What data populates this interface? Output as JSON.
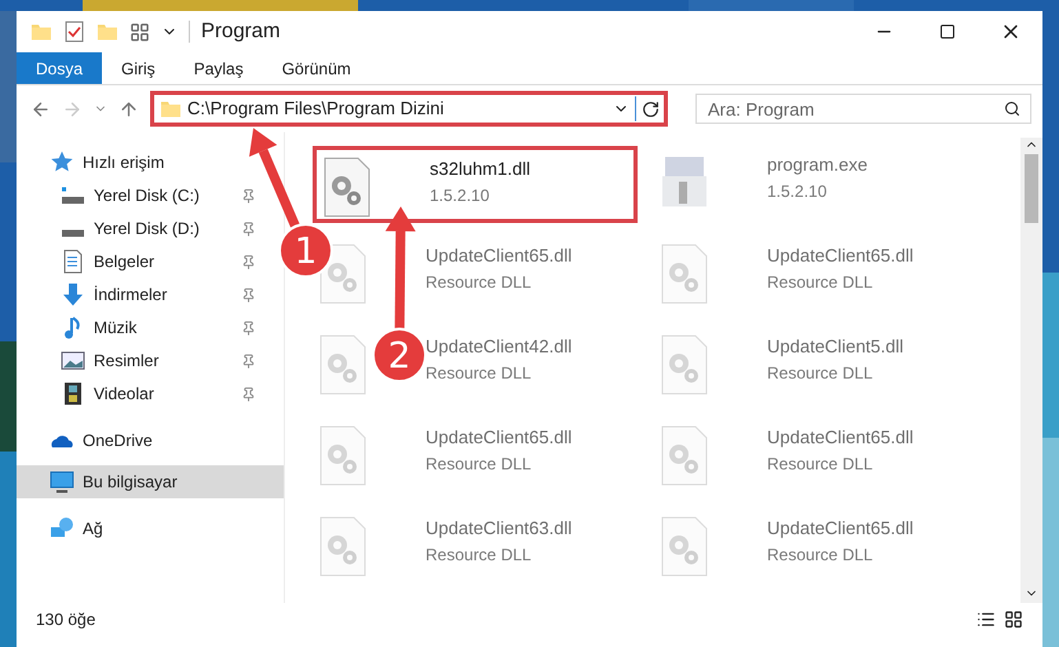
{
  "window": {
    "title": "Program"
  },
  "ribbon_tabs": [
    {
      "label": "Dosya",
      "selected": true
    },
    {
      "label": "Giriş",
      "selected": false
    },
    {
      "label": "Paylaş",
      "selected": false
    },
    {
      "label": "Görünüm",
      "selected": false
    }
  ],
  "address": {
    "path": "C:\\Program Files\\Program Dizini",
    "highlighted": true
  },
  "search": {
    "placeholder": "Ara: Program"
  },
  "sidebar": {
    "items": [
      {
        "label": "Hızlı erişim",
        "kind": "quick",
        "selected": false,
        "pinned": false
      },
      {
        "label": "Yerel Disk (C:)",
        "kind": "diskc",
        "selected": false,
        "pinned": true
      },
      {
        "label": "Yerel Disk (D:)",
        "kind": "disk",
        "selected": false,
        "pinned": true
      },
      {
        "label": "Belgeler",
        "kind": "docs",
        "selected": false,
        "pinned": true
      },
      {
        "label": "İndirmeler",
        "kind": "down",
        "selected": false,
        "pinned": true
      },
      {
        "label": "Müzik",
        "kind": "music",
        "selected": false,
        "pinned": true
      },
      {
        "label": "Resimler",
        "kind": "pics",
        "selected": false,
        "pinned": true
      },
      {
        "label": "Videolar",
        "kind": "video",
        "selected": false,
        "pinned": true
      },
      {
        "label": "OneDrive",
        "kind": "cloud",
        "selected": false,
        "pinned": false
      },
      {
        "label": "Bu bilgisayar",
        "kind": "pc",
        "selected": true,
        "pinned": false
      },
      {
        "label": "Ağ",
        "kind": "net",
        "selected": false,
        "pinned": false
      }
    ]
  },
  "files": [
    {
      "name": "s32luhm1.dll",
      "detail": "1.5.2.10",
      "kind": "dll",
      "blurred": false,
      "highlighted": true
    },
    {
      "name": "program.exe",
      "detail": "1.5.2.10",
      "kind": "exe",
      "blurred": true,
      "highlighted": false
    },
    {
      "name": "UpdateClient65.dll",
      "detail": "Resource DLL",
      "kind": "dll",
      "blurred": true,
      "highlighted": false
    },
    {
      "name": "UpdateClient65.dll",
      "detail": "Resource DLL",
      "kind": "dll",
      "blurred": true,
      "highlighted": false
    },
    {
      "name": "UpdateClient42.dll",
      "detail": "Resource DLL",
      "kind": "dll",
      "blurred": true,
      "highlighted": false
    },
    {
      "name": "UpdateClient5.dll",
      "detail": "Resource DLL",
      "kind": "dll",
      "blurred": true,
      "highlighted": false
    },
    {
      "name": "UpdateClient65.dll",
      "detail": "Resource DLL",
      "kind": "dll",
      "blurred": true,
      "highlighted": false
    },
    {
      "name": "UpdateClient65.dll",
      "detail": "Resource DLL",
      "kind": "dll",
      "blurred": true,
      "highlighted": false
    },
    {
      "name": "UpdateClient63.dll",
      "detail": "Resource DLL",
      "kind": "dll",
      "blurred": true,
      "highlighted": false
    },
    {
      "name": "UpdateClient65.dll",
      "detail": "Resource DLL",
      "kind": "dll",
      "blurred": true,
      "highlighted": false
    }
  ],
  "annotations": [
    {
      "label": "1"
    },
    {
      "label": "2"
    }
  ],
  "status_bar": {
    "count": "130 öğe"
  }
}
